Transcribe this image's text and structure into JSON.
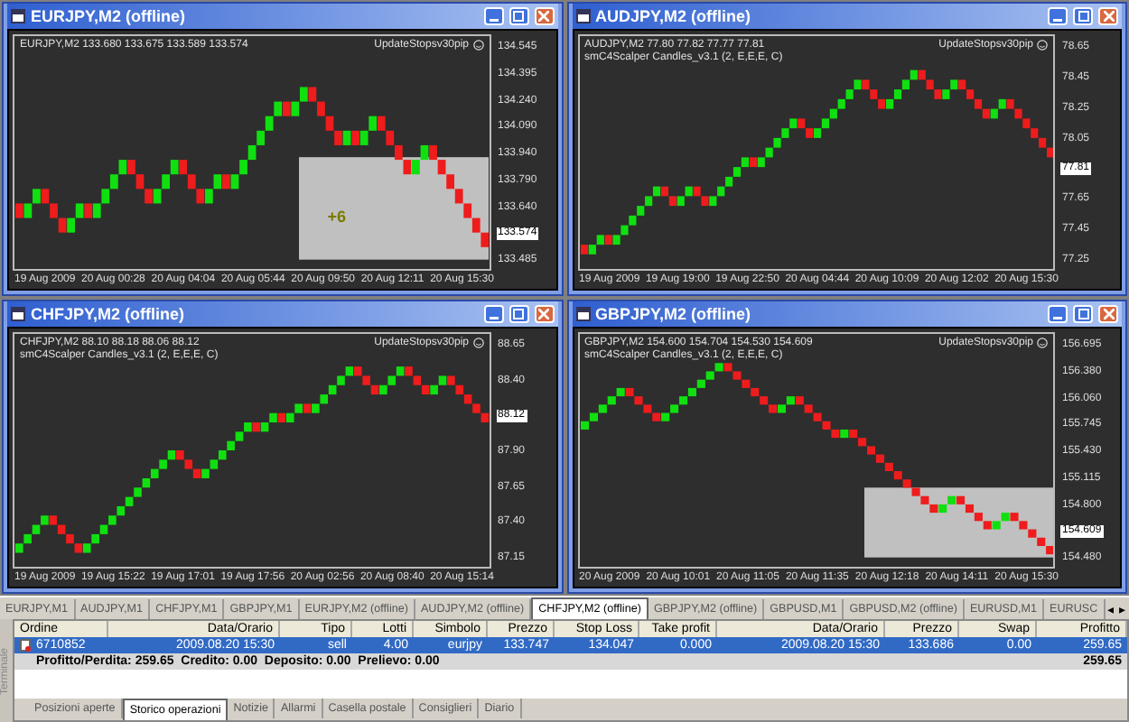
{
  "charts": [
    {
      "title": "EURJPY,M2 (offline)",
      "quote": "EURJPY,M2 133.680 133.675 133.589 133.574",
      "expert": "UpdateStopsv30pip",
      "selection": true,
      "trade_label": "+6",
      "price_ticks": [
        {
          "label": "134.545",
          "current": false
        },
        {
          "label": "134.395",
          "current": false
        },
        {
          "label": "134.240",
          "current": false
        },
        {
          "label": "134.090",
          "current": false
        },
        {
          "label": "133.940",
          "current": false
        },
        {
          "label": "133.790",
          "current": false
        },
        {
          "label": "133.640",
          "current": false
        },
        {
          "label": "133.574",
          "current": true
        },
        {
          "label": "133.485",
          "current": false
        }
      ],
      "time_ticks": [
        "19 Aug 2009",
        "20 Aug 00:28",
        "20 Aug 04:04",
        "20 Aug 05:44",
        "20 Aug 09:50",
        "20 Aug 12:11",
        "20 Aug 15:30"
      ]
    },
    {
      "title": "AUDJPY,M2 (offline)",
      "quote": "AUDJPY,M2 77.80 77.82 77.77 77.81",
      "indicator": "smC4Scalper Candles_v3.1 (2, E,E,E, C)",
      "expert": "UpdateStopsv30pip",
      "selection": false,
      "price_ticks": [
        {
          "label": "78.65",
          "current": false
        },
        {
          "label": "78.45",
          "current": false
        },
        {
          "label": "78.25",
          "current": false
        },
        {
          "label": "78.05",
          "current": false
        },
        {
          "label": "77.81",
          "current": true
        },
        {
          "label": "77.65",
          "current": false
        },
        {
          "label": "77.45",
          "current": false
        },
        {
          "label": "77.25",
          "current": false
        }
      ],
      "time_ticks": [
        "19 Aug 2009",
        "19 Aug 19:00",
        "19 Aug 22:50",
        "20 Aug 04:44",
        "20 Aug 10:09",
        "20 Aug 12:02",
        "20 Aug 15:30"
      ]
    },
    {
      "title": "CHFJPY,M2 (offline)",
      "quote": "CHFJPY,M2 88.10 88.18 88.06 88.12",
      "indicator": "smC4Scalper Candles_v3.1 (2, E,E,E, C)",
      "expert": "UpdateStopsv30pip",
      "selection": false,
      "price_ticks": [
        {
          "label": "88.65",
          "current": false
        },
        {
          "label": "88.40",
          "current": false
        },
        {
          "label": "88.12",
          "current": true
        },
        {
          "label": "87.90",
          "current": false
        },
        {
          "label": "87.65",
          "current": false
        },
        {
          "label": "87.40",
          "current": false
        },
        {
          "label": "87.15",
          "current": false
        }
      ],
      "time_ticks": [
        "19 Aug 2009",
        "19 Aug 15:22",
        "19 Aug 17:01",
        "19 Aug 17:56",
        "20 Aug 02:56",
        "20 Aug 08:40",
        "20 Aug 15:14"
      ]
    },
    {
      "title": "GBPJPY,M2 (offline)",
      "quote": "GBPJPY,M2 154.600 154.704 154.530 154.609",
      "indicator": "smC4Scalper Candles_v3.1 (2, E,E,E, C)",
      "expert": "UpdateStopsv30pip",
      "selection": true,
      "price_ticks": [
        {
          "label": "156.695",
          "current": false
        },
        {
          "label": "156.380",
          "current": false
        },
        {
          "label": "156.060",
          "current": false
        },
        {
          "label": "155.745",
          "current": false
        },
        {
          "label": "155.430",
          "current": false
        },
        {
          "label": "155.115",
          "current": false
        },
        {
          "label": "154.800",
          "current": false
        },
        {
          "label": "154.609",
          "current": true
        },
        {
          "label": "154.480",
          "current": false
        }
      ],
      "time_ticks": [
        "20 Aug 2009",
        "20 Aug 10:01",
        "20 Aug 11:05",
        "20 Aug 11:35",
        "20 Aug 12:18",
        "20 Aug 14:11",
        "20 Aug 15:30"
      ]
    }
  ],
  "chart_tabs": [
    {
      "label": "EURJPY,M1",
      "selected": false
    },
    {
      "label": "AUDJPY,M1",
      "selected": false
    },
    {
      "label": "CHFJPY,M1",
      "selected": false
    },
    {
      "label": "GBPJPY,M1",
      "selected": false
    },
    {
      "label": "EURJPY,M2 (offline)",
      "selected": false
    },
    {
      "label": "AUDJPY,M2 (offline)",
      "selected": false
    },
    {
      "label": "CHFJPY,M2 (offline)",
      "selected": true
    },
    {
      "label": "GBPJPY,M2 (offline)",
      "selected": false
    },
    {
      "label": "GBPUSD,M1",
      "selected": false
    },
    {
      "label": "GBPUSD,M2 (offline)",
      "selected": false
    },
    {
      "label": "EURUSD,M1",
      "selected": false
    },
    {
      "label": "EURUSC",
      "selected": false
    }
  ],
  "tab_scroll": [
    "◂",
    "▸"
  ],
  "terminal_label": "Terminale",
  "table": {
    "columns": [
      "Ordine",
      "Data/Orario",
      "Tipo",
      "Lotti",
      "Simbolo",
      "Prezzo",
      "Stop Loss",
      "Take profit",
      "Data/Orario",
      "Prezzo",
      "Swap",
      "Profitto"
    ],
    "rows": [
      {
        "selected": true,
        "cells": [
          "6710852",
          "2009.08.20 15:30",
          "sell",
          "4.00",
          "eurjpy",
          "133.747",
          "134.047",
          "0.000",
          "2009.08.20 15:30",
          "133.686",
          "0.00",
          "259.65"
        ]
      }
    ],
    "summary": "Profitto/Perdita: 259.65  Credito: 0.00  Deposito: 0.00  Prelievo: 0.00",
    "summary_total": "259.65"
  },
  "terminal_tabs": [
    {
      "label": "Posizioni aperte",
      "selected": false
    },
    {
      "label": "Storico operazioni",
      "selected": true
    },
    {
      "label": "Notizie",
      "selected": false
    },
    {
      "label": "Allarmi",
      "selected": false
    },
    {
      "label": "Casella postale",
      "selected": false
    },
    {
      "label": "Consiglieri",
      "selected": false
    },
    {
      "label": "Diario",
      "selected": false
    }
  ]
}
